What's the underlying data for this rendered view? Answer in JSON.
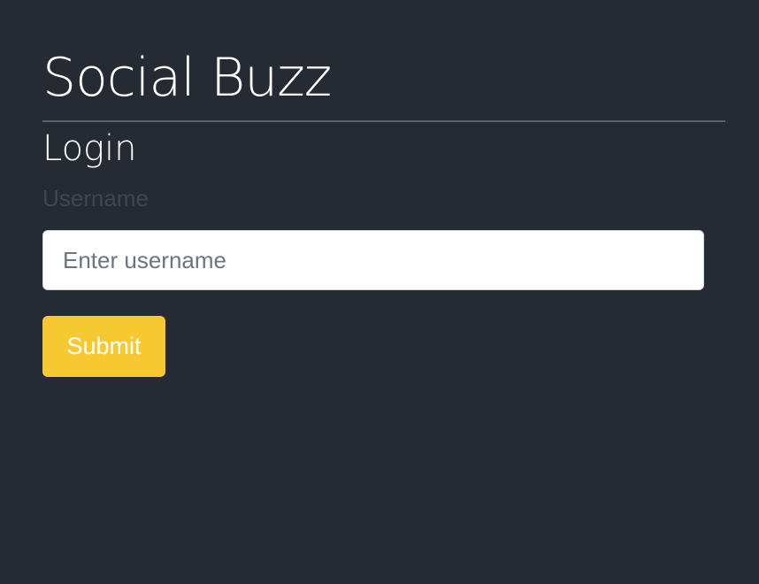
{
  "app": {
    "title": "Social Buzz"
  },
  "login": {
    "heading": "Login",
    "username_label": "Username",
    "username_placeholder": "Enter username",
    "username_value": "",
    "submit_label": "Submit"
  },
  "colors": {
    "background": "#262b33",
    "accent": "#f5c92f",
    "label_text": "#3f4650",
    "divider": "#5c6168"
  }
}
